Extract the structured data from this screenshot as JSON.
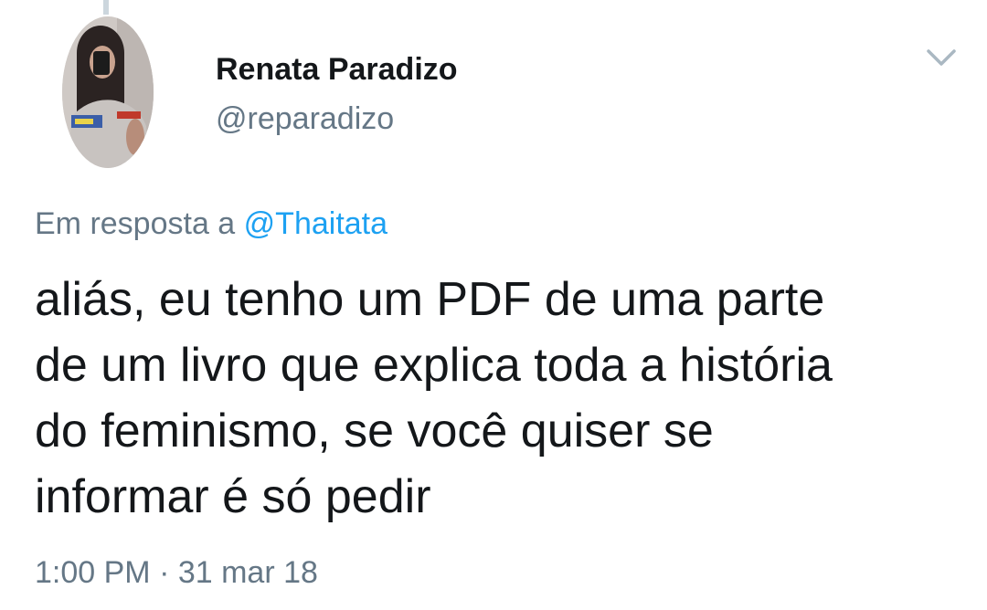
{
  "tweet": {
    "author_name": "Renata Paradizo",
    "author_handle": "@reparadizo",
    "menu_icon": "chevron-down-icon",
    "reply_prefix": "Em resposta a",
    "reply_mention": "@Thaitata",
    "text_lines": [
      "aliás, eu tenho um PDF de uma parte",
      "de um livro que explica toda a história",
      "do feminismo, se você quiser se",
      "informar é só pedir"
    ],
    "timestamp": "1:00 PM · 31 mar 18"
  },
  "colors": {
    "primary_text": "#14171a",
    "secondary_text": "#657786",
    "link": "#1da1f2",
    "thread_line": "#ccd6dd"
  }
}
